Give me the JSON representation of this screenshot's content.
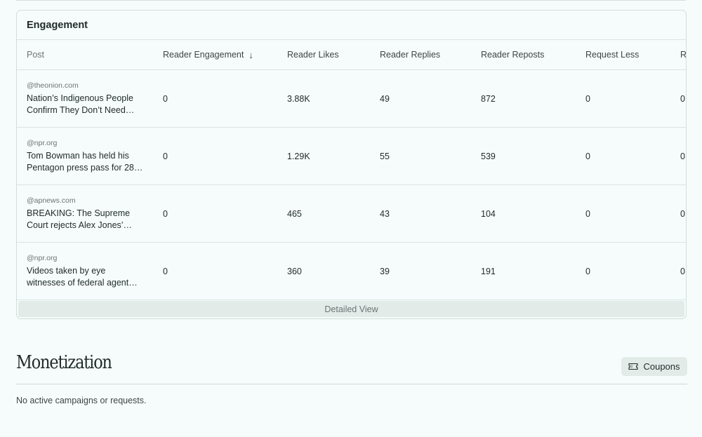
{
  "engagement": {
    "title": "Engagement",
    "columns": [
      "Post",
      "Reader Engagement",
      "Reader Likes",
      "Reader Replies",
      "Reader Reposts",
      "Request Less",
      "R"
    ],
    "rows": [
      {
        "source": "@theonion.com",
        "text": "Nation’s Indigenous People Confirm They Don’t Need…",
        "engagement": "0",
        "likes": "3.88K",
        "replies": "49",
        "reposts": "872",
        "request_less": "0",
        "extra": "0"
      },
      {
        "source": "@npr.org",
        "text": "Tom Bowman has held his Pentagon press pass for 28…",
        "engagement": "0",
        "likes": "1.29K",
        "replies": "55",
        "reposts": "539",
        "request_less": "0",
        "extra": "0"
      },
      {
        "source": "@apnews.com",
        "text": "BREAKING: The Supreme Court rejects Alex Jones’…",
        "engagement": "0",
        "likes": "465",
        "replies": "43",
        "reposts": "104",
        "request_less": "0",
        "extra": "0"
      },
      {
        "source": "@npr.org",
        "text": "Videos taken by eye witnesses of federal agent…",
        "engagement": "0",
        "likes": "360",
        "replies": "39",
        "reposts": "191",
        "request_less": "0",
        "extra": "0"
      }
    ],
    "detailed_view_label": "Detailed View"
  },
  "monetization": {
    "title": "Monetization",
    "coupons_label": "Coupons",
    "empty_text": "No active campaigns or requests."
  },
  "icons": {
    "sort": "arrow-down-icon",
    "coupons": "ticket-icon"
  }
}
